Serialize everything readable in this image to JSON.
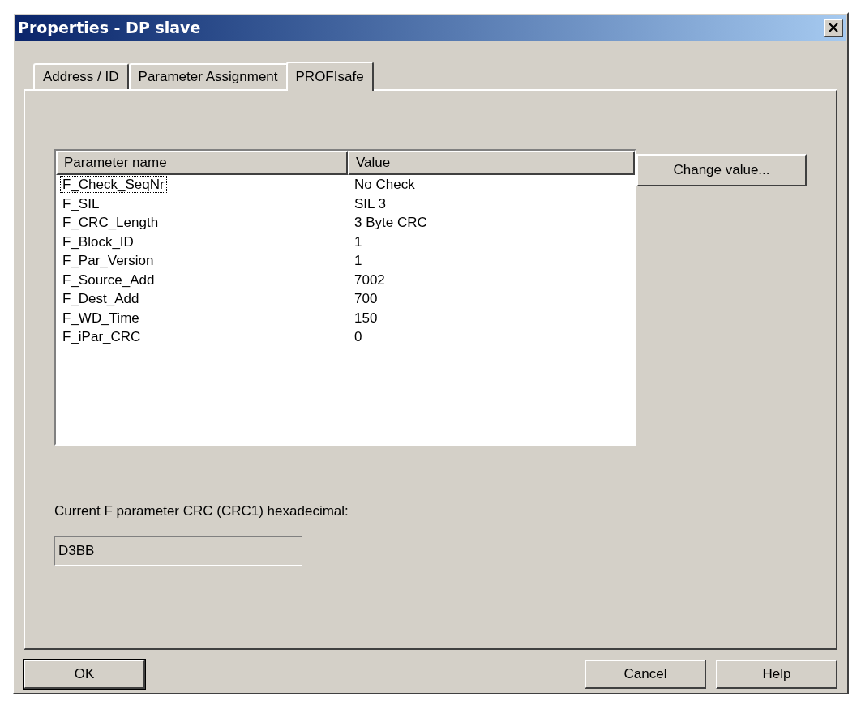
{
  "window": {
    "title": "Properties - DP slave"
  },
  "tabs": [
    {
      "label": "Address / ID",
      "selected": false
    },
    {
      "label": "Parameter Assignment",
      "selected": false
    },
    {
      "label": "PROFIsafe",
      "selected": true
    }
  ],
  "table": {
    "columns": [
      "Parameter name",
      "Value"
    ],
    "rows": [
      {
        "name": "F_Check_SeqNr",
        "value": "No Check",
        "focused": true
      },
      {
        "name": "F_SIL",
        "value": "SIL 3",
        "focused": false
      },
      {
        "name": "F_CRC_Length",
        "value": "3 Byte CRC",
        "focused": false
      },
      {
        "name": "F_Block_ID",
        "value": "1",
        "focused": false
      },
      {
        "name": "F_Par_Version",
        "value": "1",
        "focused": false
      },
      {
        "name": "F_Source_Add",
        "value": "7002",
        "focused": false
      },
      {
        "name": "F_Dest_Add",
        "value": "700",
        "focused": false
      },
      {
        "name": "F_WD_Time",
        "value": "150",
        "focused": false
      },
      {
        "name": "F_iPar_CRC",
        "value": "0",
        "focused": false
      }
    ]
  },
  "change_button": "Change value...",
  "crc": {
    "label": "Current F parameter CRC (CRC1) hexadecimal:",
    "value": "D3BB"
  },
  "buttons": [
    {
      "label": "OK",
      "default": true
    },
    {
      "label": "Cancel",
      "default": false
    },
    {
      "label": "Help",
      "default": false
    }
  ]
}
